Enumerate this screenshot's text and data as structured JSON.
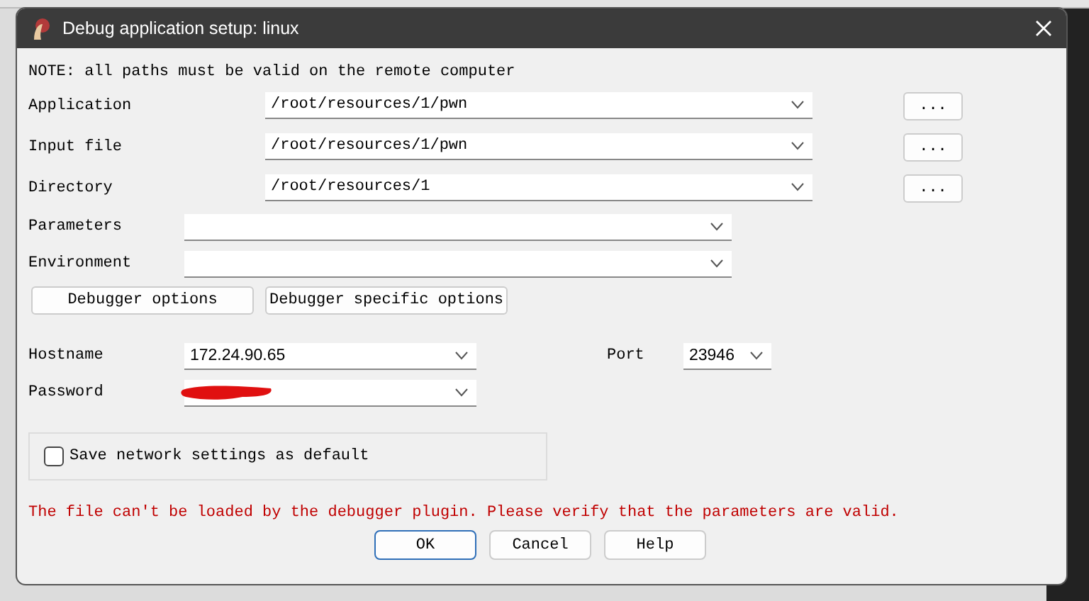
{
  "window": {
    "title": "Debug application setup: linux"
  },
  "note": "NOTE: all paths must be valid on the remote computer",
  "fields": [
    {
      "kind": "path",
      "label": "Application",
      "value": "/root/resources/1/pwn",
      "browse": "..."
    },
    {
      "kind": "path",
      "label": "Input file",
      "value": "/root/resources/1/pwn",
      "browse": "..."
    },
    {
      "kind": "path",
      "label": "Directory",
      "value": "/root/resources/1",
      "browse": "..."
    },
    {
      "kind": "combo",
      "label": "Parameters"
    },
    {
      "kind": "combo",
      "label": "Environment"
    }
  ],
  "option_buttons": [
    "Debugger options",
    "Debugger specific options"
  ],
  "hostname": {
    "label": "Hostname",
    "value": "172.24.90.65"
  },
  "port": {
    "label": "Port",
    "value": "23946"
  },
  "password": {
    "label": "Password",
    "redacted": true
  },
  "save_checkbox": {
    "label": "Save network settings as default",
    "checked": false
  },
  "error": "The file can't be loaded by the debugger plugin. Please verify that the parameters are valid.",
  "buttons": [
    {
      "label": "OK",
      "default": true
    },
    {
      "label": "Cancel",
      "default": false
    },
    {
      "label": "Help",
      "default": false
    }
  ]
}
